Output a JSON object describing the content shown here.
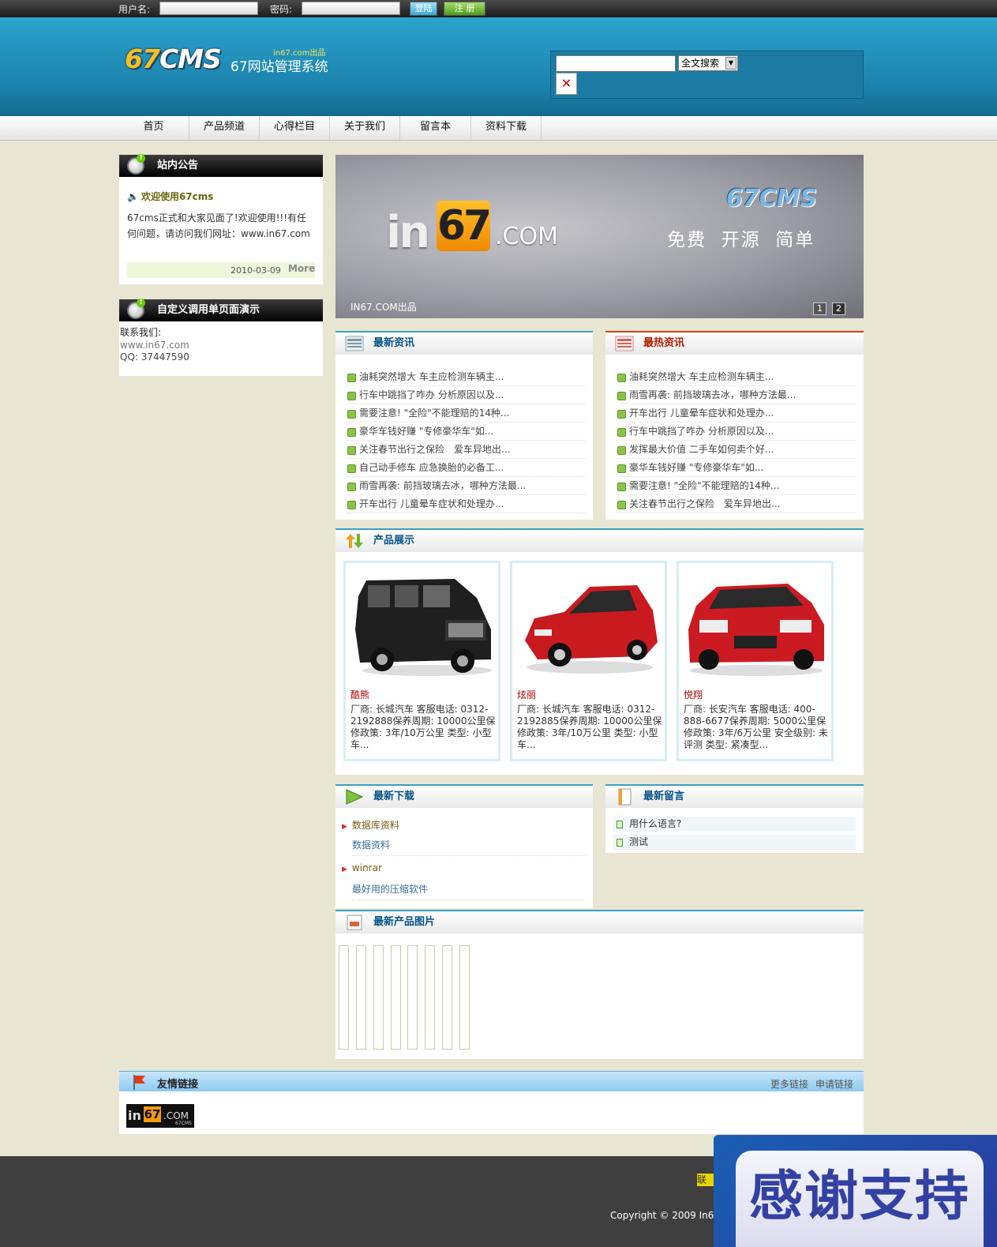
{
  "topbar": {
    "username_label": "用户名:",
    "password_label": "密码:",
    "login_label": "登陆",
    "register_label": "注 册"
  },
  "header": {
    "logo_num": "67",
    "logo_text": "CMS",
    "site_name": "67网站管理系统",
    "site_tag": "in67.com出品",
    "search_option": "全文搜索"
  },
  "nav": {
    "items": [
      {
        "label": "首页"
      },
      {
        "label": "产品频道"
      },
      {
        "label": "心得栏目"
      },
      {
        "label": "关于我们"
      },
      {
        "label": "留言本"
      },
      {
        "label": "资料下载"
      }
    ]
  },
  "notice": {
    "title": "站内公告",
    "headline": "欢迎使用67cms",
    "body": "67cms正式和大家见面了!欢迎使用!!!有任何问题，请访问我们网址：www.in67.com",
    "date": "2010-03-09",
    "more": "More"
  },
  "custom": {
    "title": "自定义调用单页面演示",
    "line1": "联系我们:",
    "line2": "www.in67.com",
    "line3": "QQ: 37447590"
  },
  "banner": {
    "brand_in": "in",
    "brand_67": "67",
    "brand_com": ".COM",
    "title": "67CMS",
    "slogan": "免费  开源  简单",
    "credit": "IN67.COM出品",
    "pages": [
      "1",
      "2"
    ]
  },
  "latest_news": {
    "title": "最新资讯",
    "items": [
      "油耗突然增大 车主应检测车辆主...",
      "行车中跳挡了咋办 分析原因以及...",
      "需要注意! \"全险\"不能理赔的14种...",
      "豪华车钱好赚 \"专修豪华车\"如...",
      "关注春节出行之保险　爱车异地出...",
      "自己动手修车 应急换胎的必备工...",
      "雨雪再袭: 前挡玻璃去冰，哪种方法最...",
      "开车出行 儿童晕车症状和处理办..."
    ]
  },
  "hot_news": {
    "title": "最热资讯",
    "items": [
      "油耗突然增大 车主应检测车辆主...",
      "雨雪再袭: 前挡玻璃去冰，哪种方法最...",
      "开车出行 儿童晕车症状和处理办...",
      "行车中跳挡了咋办 分析原因以及...",
      "发挥最大价值 二手车如何卖个好...",
      "豪华车钱好赚 \"专修豪华车\"如...",
      "需要注意! \"全险\"不能理赔的14种...",
      "关注春节出行之保险　爱车异地出..."
    ]
  },
  "products": {
    "title": "产品展示",
    "items": [
      {
        "name": "酷熊",
        "desc": "厂商: 长城汽车 客服电话: 0312-2192888保养周期: 10000公里保修政策: 3年/10万公里 类型: 小型车...",
        "color": "#1f1f1f"
      },
      {
        "name": "炫丽",
        "desc": "厂商: 长城汽车 客服电话: 0312-2192885保养周期: 10000公里保修政策: 3年/10万公里 类型: 小型车...",
        "color": "#c81a1f"
      },
      {
        "name": "悦翔",
        "desc": "厂商: 长安汽车 客服电话: 400-888-6677保养周期: 5000公里保修政策: 3年/6万公里 安全级别: 未评测 类型: 紧凑型...",
        "color": "#cc1a22"
      }
    ]
  },
  "downloads": {
    "title": "最新下载",
    "items": [
      {
        "name": "数据库资料",
        "desc": "数据资料"
      },
      {
        "name": "winrar",
        "desc": "最好用的压缩软件"
      }
    ]
  },
  "messages": {
    "title": "最新留言",
    "items": [
      "用什么语言?",
      "测试"
    ]
  },
  "product_images": {
    "title": "最新产品图片"
  },
  "links": {
    "title": "友情链接",
    "more": "更多链接",
    "apply": "申请链接",
    "logo_in": "in",
    "logo_67": "67",
    "logo_com": ".COM",
    "logo_sub": "67CMS"
  },
  "footer": {
    "contact_partial": "联系",
    "copyright": "Copyright © 2009 In6"
  },
  "overlay": {
    "text": "感谢支持"
  }
}
